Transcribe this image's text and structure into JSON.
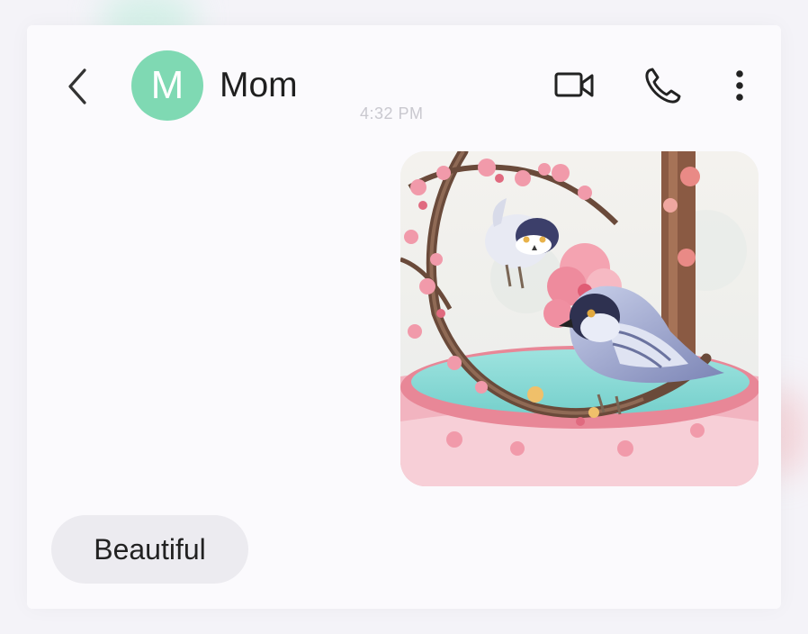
{
  "header": {
    "contact_name": "Mom",
    "avatar_initial": "M",
    "avatar_color": "#7fd9b3",
    "icons": [
      "back-arrow-icon",
      "video-camera-icon",
      "phone-icon",
      "more-vertical-icon"
    ]
  },
  "conversation": {
    "timestamp": "4:32 PM",
    "messages": [
      {
        "type": "image",
        "direction": "sent",
        "content": "illustration of two birds on a cherry blossom branch"
      },
      {
        "type": "text",
        "direction": "received",
        "text": "Beautiful"
      }
    ]
  },
  "colors": {
    "background": "#f4f3f8",
    "received_bubble": "#ecebf0",
    "accent": "#7fd9b3"
  }
}
